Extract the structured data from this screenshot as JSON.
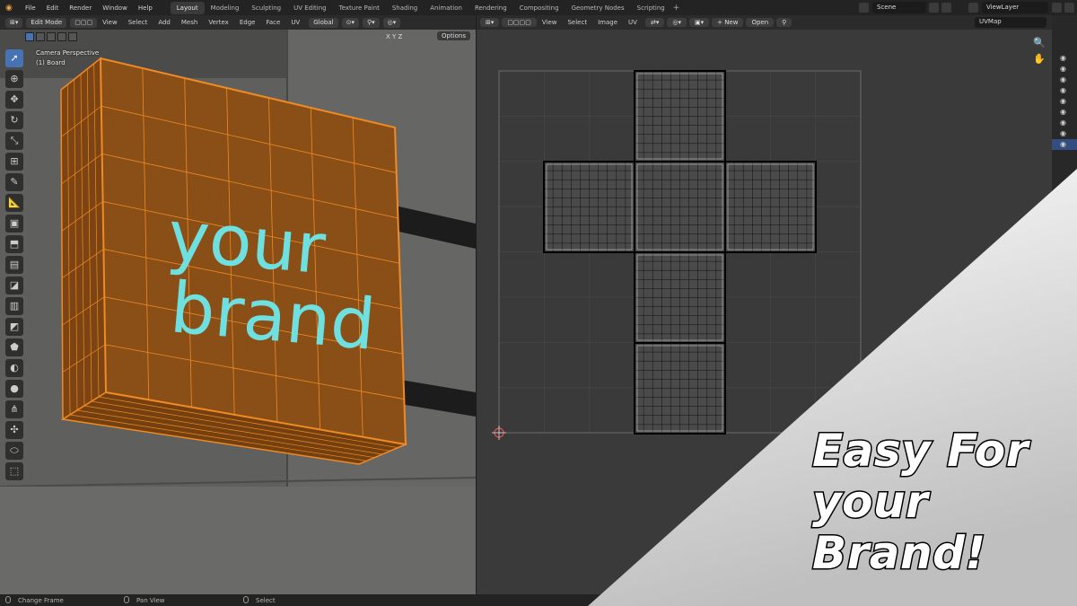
{
  "topbar": {
    "menus": [
      "File",
      "Edit",
      "Render",
      "Window",
      "Help"
    ],
    "workspace_tabs": [
      "Layout",
      "Modeling",
      "Sculpting",
      "UV Editing",
      "Texture Paint",
      "Shading",
      "Animation",
      "Rendering",
      "Compositing",
      "Geometry Nodes",
      "Scripting"
    ],
    "active_tab": "Layout",
    "scene": "Scene",
    "view_layer": "ViewLayer"
  },
  "viewport": {
    "mode": "Edit Mode",
    "menus": [
      "View",
      "Select",
      "Add",
      "Mesh",
      "Vertex",
      "Edge",
      "Face",
      "UV"
    ],
    "transform_orientation": "Global",
    "axes": "X Y Z",
    "options_label": "Options",
    "camera_label": "Camera Perspective",
    "object_label": "(1) Board",
    "sign_text_line1": "your",
    "sign_text_line2": "brand",
    "colors": {
      "board": "#8a4f16",
      "wire": "#f08a24",
      "sign_text": "#6fe0e0",
      "wall": "#5c5c5a"
    }
  },
  "uv_editor": {
    "menus": [
      "View",
      "Select",
      "Image",
      "UV"
    ],
    "new_label": "+ New",
    "open_label": "Open",
    "uv_map": "UVMap"
  },
  "statusbar": {
    "hint1": "Change Frame",
    "hint2": "Pan View",
    "hint3": "Select"
  },
  "promo": {
    "line1": "Easy For",
    "line2": "your Brand!"
  }
}
